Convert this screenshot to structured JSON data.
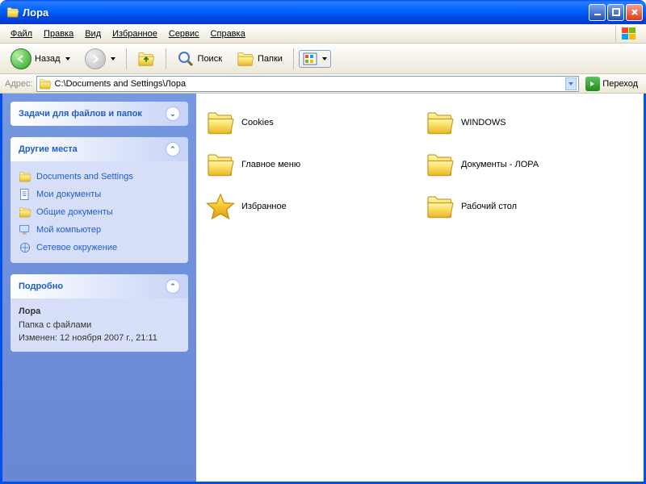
{
  "titlebar": {
    "title": "Лора"
  },
  "menu": {
    "file": "Файл",
    "edit": "Правка",
    "view": "Вид",
    "favorites": "Избранное",
    "service": "Сервис",
    "help": "Справка"
  },
  "toolbar": {
    "back": "Назад",
    "search": "Поиск",
    "folders": "Папки"
  },
  "address": {
    "label": "Адрес:",
    "path": "C:\\Documents and Settings\\Лора",
    "go": "Переход"
  },
  "sidebar": {
    "tasks": {
      "title": "Задачи для файлов и папок"
    },
    "places": {
      "title": "Другие места",
      "items": [
        {
          "label": "Documents and Settings",
          "icon": "folder"
        },
        {
          "label": "Мои документы",
          "icon": "mydocs"
        },
        {
          "label": "Общие документы",
          "icon": "shared"
        },
        {
          "label": "Мой компьютер",
          "icon": "computer"
        },
        {
          "label": "Сетевое окружение",
          "icon": "network"
        }
      ]
    },
    "details": {
      "title": "Подробно",
      "name": "Лора",
      "type": "Папка с файлами",
      "modified": "Изменен: 12 ноября 2007 г., 21:11"
    }
  },
  "files": [
    {
      "label": "Cookies",
      "icon": "folder"
    },
    {
      "label": "WINDOWS",
      "icon": "folder"
    },
    {
      "label": "Главное меню",
      "icon": "folder"
    },
    {
      "label": "Документы - ЛОРА",
      "icon": "folder"
    },
    {
      "label": "Избранное",
      "icon": "star"
    },
    {
      "label": "Рабочий стол",
      "icon": "folder"
    }
  ]
}
